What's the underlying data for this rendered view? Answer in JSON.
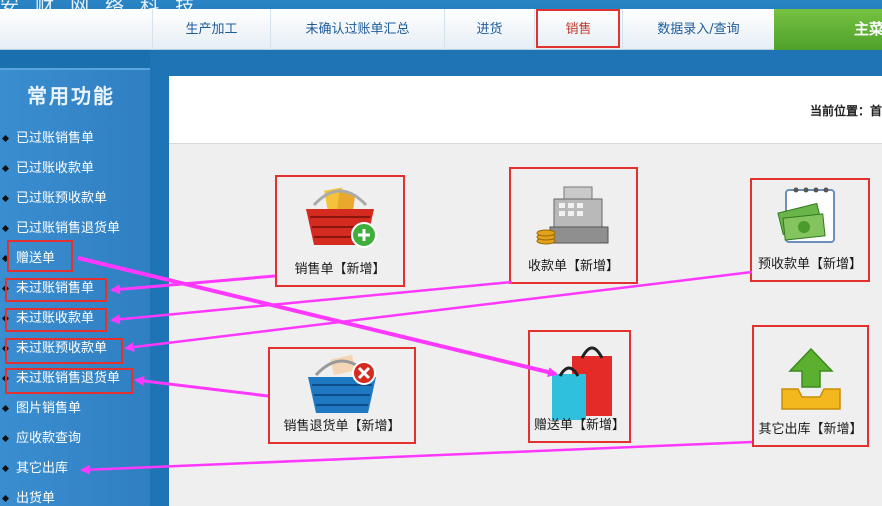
{
  "brand": {
    "text": "安 财 网 络 科 技"
  },
  "nav": {
    "items": [
      "生产加工",
      "未确认过账单汇总",
      "进货",
      "销售",
      "数据录入/查询"
    ],
    "main_menu_label": "主菜"
  },
  "sidebar": {
    "title": "常用功能",
    "items": [
      "已过账销售单",
      "已过账收款单",
      "已过账预收款单",
      "已过账销售退货单",
      "赠送单",
      "未过账销售单",
      "未过账收款单",
      "未过账预收款单",
      "未过账销售退货单",
      "图片销售单",
      "应收款查询",
      "其它出库",
      "出货单"
    ]
  },
  "breadcrumb": {
    "label": "当前位置：首"
  },
  "tiles": [
    {
      "label": "销售单【新增】",
      "icon": "shopping-basket-add-icon"
    },
    {
      "label": "收款单【新增】",
      "icon": "cash-register-icon"
    },
    {
      "label": "预收款单【新增】",
      "icon": "money-notebook-icon"
    },
    {
      "label": "销售退货单【新增】",
      "icon": "basket-remove-icon"
    },
    {
      "label": "赠送单【新增】",
      "icon": "shopping-bags-icon"
    },
    {
      "label": "其它出库【新增】",
      "icon": "tray-upload-icon"
    }
  ],
  "colors": {
    "highlight": "#e2312f",
    "arrow": "#ff38ff",
    "accent_green": "#5cb030"
  }
}
